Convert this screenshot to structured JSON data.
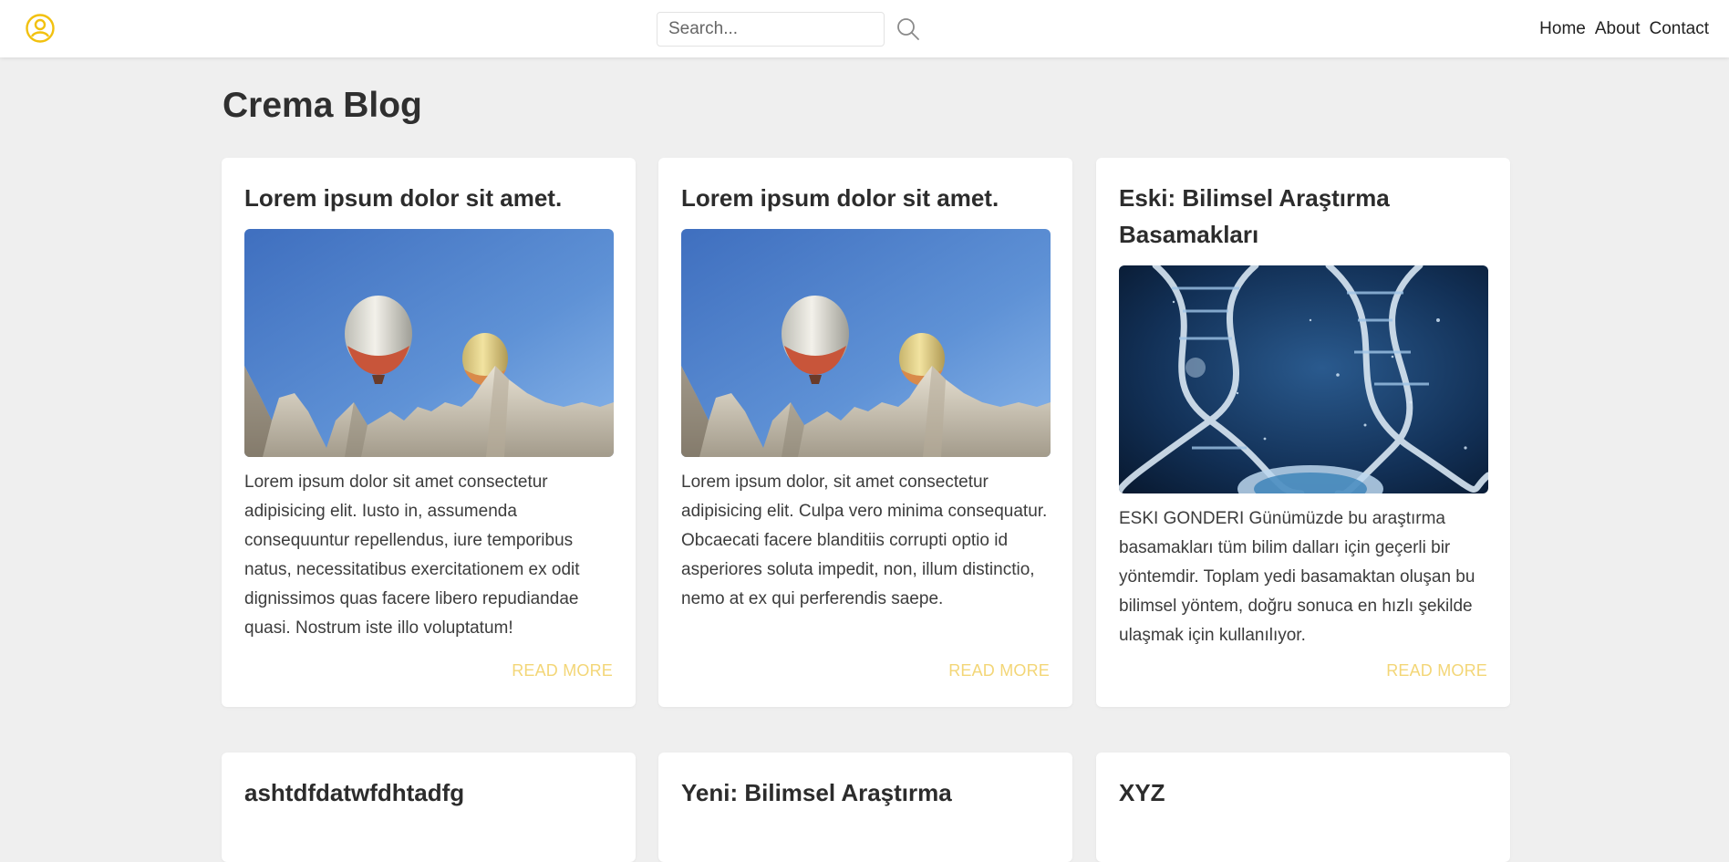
{
  "header": {
    "search": {
      "placeholder": "Search...",
      "value": ""
    },
    "nav": [
      {
        "label": "Home"
      },
      {
        "label": "About"
      },
      {
        "label": "Contact"
      }
    ],
    "icons": {
      "user": "user-circle-icon",
      "search": "search-icon"
    },
    "accent_color": "#f2c10f"
  },
  "main": {
    "title": "Crema Blog",
    "posts": [
      {
        "title": "Lorem ipsum dolor sit amet.",
        "image": "hot-air-balloons-over-rocks",
        "excerpt": "Lorem ipsum dolor sit amet consectetur adipisicing elit. Iusto in, assumenda consequuntur repellendus, iure temporibus natus, necessitatibus exercitationem ex odit dignissimos quas facere libero repudiandae quasi. Nostrum iste illo voluptatum!",
        "read_more": "READ MORE"
      },
      {
        "title": "Lorem ipsum dolor sit amet.",
        "image": "hot-air-balloons-over-rocks",
        "excerpt": "Lorem ipsum dolor, sit amet consectetur adipisicing elit. Culpa vero minima consequatur. Obcaecati facere blanditiis corrupti optio id asperiores soluta impedit, non, illum distinctio, nemo at ex qui perferendis saepe.",
        "read_more": "READ MORE"
      },
      {
        "title": "Eski: Bilimsel Araştırma Basamakları",
        "image": "dna-helix",
        "excerpt": "ESKI GONDERI Günümüzde bu araştırma basamakları tüm bilim dalları için geçerli bir yöntemdir. Toplam yedi basamaktan oluşan bu bilimsel yöntem, doğru sonuca en hızlı şekilde ulaşmak için kullanılıyor.",
        "read_more": "READ MORE"
      },
      {
        "title": "ashtdfdatwfdhtadfg"
      },
      {
        "title": "Yeni: Bilimsel Araştırma"
      },
      {
        "title": "XYZ"
      }
    ]
  }
}
